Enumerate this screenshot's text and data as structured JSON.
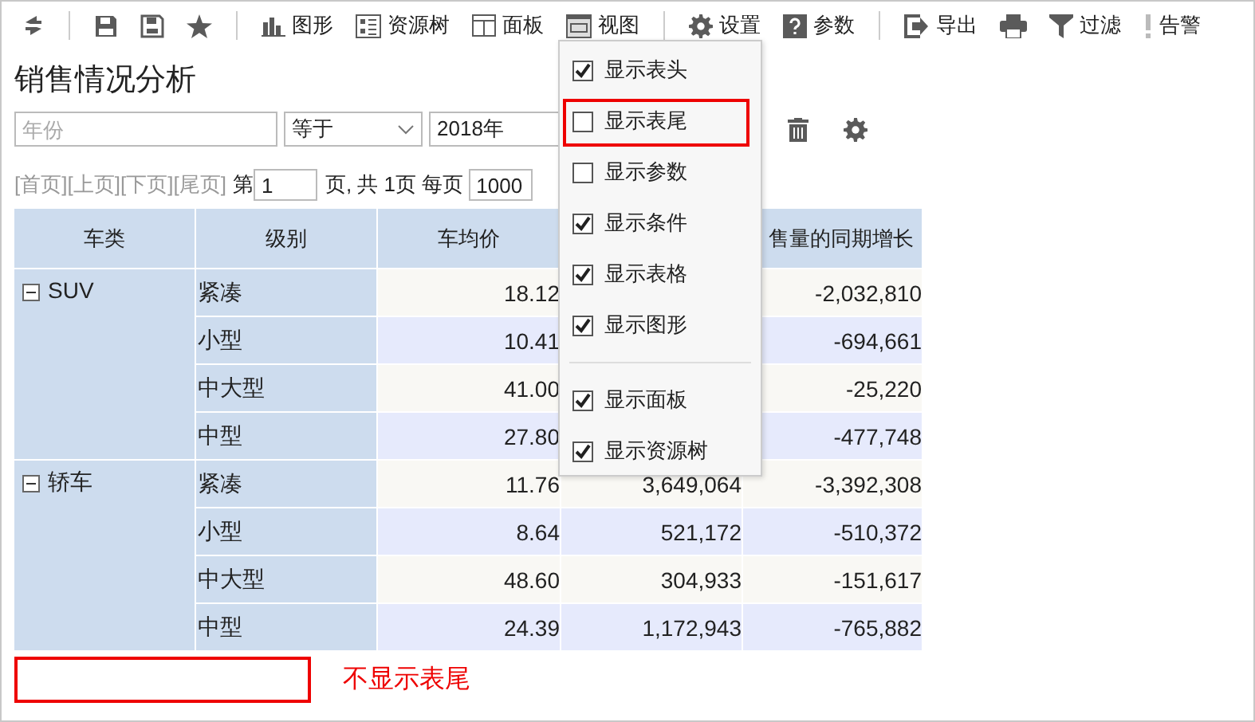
{
  "toolbar": {
    "items": [
      {
        "kind": "icon"
      },
      {
        "kind": "separator"
      },
      {
        "kind": "icon"
      },
      {
        "kind": "icon"
      },
      {
        "kind": "icon"
      },
      {
        "kind": "separator"
      },
      {
        "kind": "button",
        "label": "图形"
      },
      {
        "kind": "button",
        "label": "资源树"
      },
      {
        "kind": "button",
        "label": "面板"
      },
      {
        "kind": "button",
        "label": "视图"
      },
      {
        "kind": "separator"
      },
      {
        "kind": "button",
        "label": "设置"
      },
      {
        "kind": "button",
        "label": "参数"
      },
      {
        "kind": "separator"
      },
      {
        "kind": "button",
        "label": "导出"
      },
      {
        "kind": "icon"
      },
      {
        "kind": "button",
        "label": "过滤"
      },
      {
        "kind": "button",
        "label": "告警"
      }
    ]
  },
  "report": {
    "title": "销售情况分析",
    "filter": {
      "field": {
        "placeholder": "年份"
      },
      "operator": "等于",
      "value": "2018年"
    },
    "pager": {
      "links": [
        "[首页]",
        "[上页]",
        "[下页]",
        "[尾页]"
      ],
      "page_prefix": "第",
      "page": "1",
      "page_suffix": "页, 共 1页 每页",
      "page_size": "1000"
    },
    "table": {
      "columns": [
        "车类",
        "级别",
        "车均价",
        null,
        "售量的同期增长"
      ],
      "groups": [
        {
          "name": "SUV",
          "expanded": true,
          "rows": [
            {
              "level": "紧凑",
              "avg_price": "18.12",
              "growth": "-2,032,810"
            },
            {
              "level": "小型",
              "avg_price": "10.41",
              "growth": "-694,661"
            },
            {
              "level": "中大型",
              "avg_price": "41.00",
              "growth": "-25,220"
            },
            {
              "level": "中型",
              "avg_price": "27.80",
              "growth": "-477,748"
            }
          ]
        },
        {
          "name": "轿车",
          "expanded": true,
          "rows": [
            {
              "level": "紧凑",
              "avg_price": "11.76",
              "column_4": "3,649,064",
              "growth": "-3,392,308"
            },
            {
              "level": "小型",
              "avg_price": "8.64",
              "column_4": "521,172",
              "growth": "-510,372"
            },
            {
              "level": "中大型",
              "avg_price": "48.60",
              "column_4": "304,933",
              "growth": "-151,617"
            },
            {
              "level": "中型",
              "avg_price": "24.39",
              "column_4": "1,172,943",
              "growth": "-765,882"
            }
          ]
        }
      ]
    },
    "note": "不显示表尾"
  },
  "menu": {
    "sections": [
      {
        "items": [
          {
            "label": "显示表头",
            "checked": true,
            "highlighted": false
          },
          {
            "label": "显示表尾",
            "checked": false,
            "highlighted": true
          },
          {
            "label": "显示参数",
            "checked": false,
            "highlighted": false
          },
          {
            "label": "显示条件",
            "checked": true,
            "highlighted": false
          },
          {
            "label": "显示表格",
            "checked": true,
            "highlighted": false
          },
          {
            "label": "显示图形",
            "checked": true,
            "highlighted": false
          }
        ]
      },
      {
        "items": [
          {
            "label": "显示面板",
            "checked": true,
            "highlighted": false
          },
          {
            "label": "显示资源树",
            "checked": true,
            "highlighted": false
          }
        ]
      }
    ]
  }
}
